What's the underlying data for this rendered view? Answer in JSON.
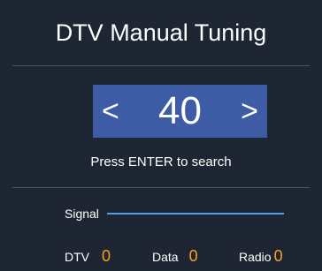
{
  "title": "DTV Manual Tuning",
  "channel": {
    "left_arrow": "<",
    "number": "40",
    "right_arrow": ">"
  },
  "hint": "Press ENTER to search",
  "signal": {
    "label": "Signal"
  },
  "counts": {
    "dtv_label": "DTV",
    "dtv_value": "0",
    "data_label": "Data",
    "data_value": "0",
    "radio_label": "Radio",
    "radio_value": "0"
  },
  "colors": {
    "background": "#1e2533",
    "channel_highlight": "#3e5ca6",
    "signal_bar": "#4aa3e8",
    "count_value": "#f2a31c"
  }
}
